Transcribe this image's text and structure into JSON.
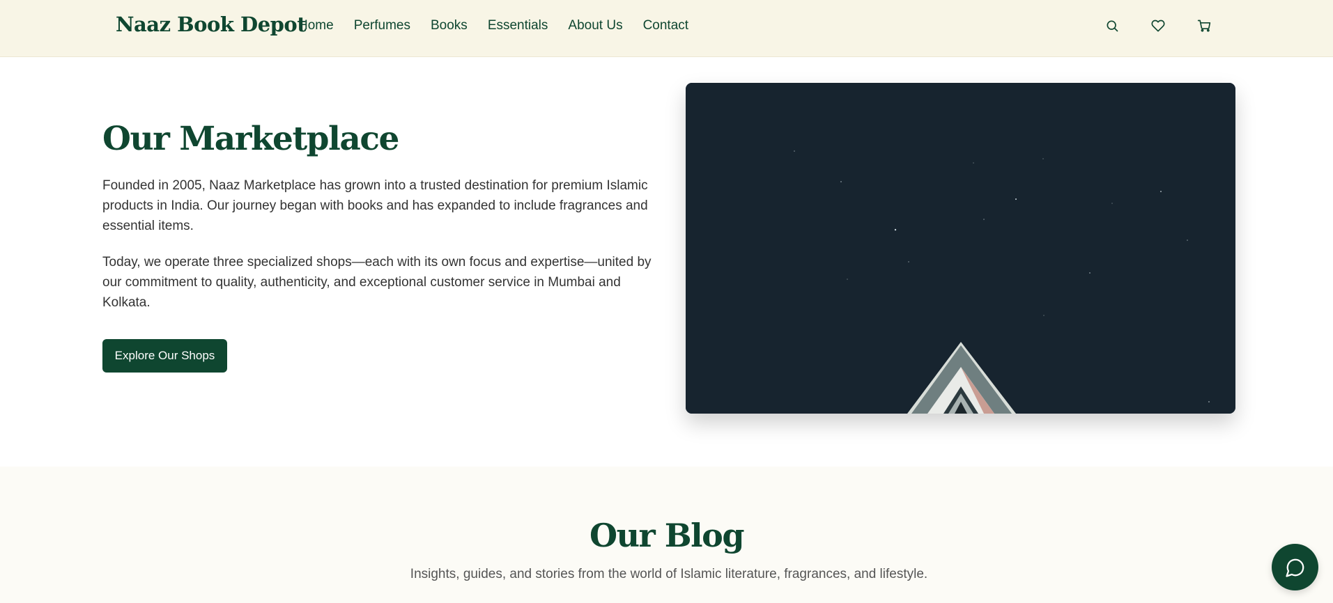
{
  "header": {
    "brand": "Naaz Book Depot",
    "nav": [
      "Home",
      "Perfumes",
      "Books",
      "Essentials",
      "About Us",
      "Contact"
    ],
    "icons": [
      "search-icon",
      "heart-icon",
      "cart-icon"
    ]
  },
  "hero": {
    "title": "Our Marketplace",
    "paragraph1": "Founded in 2005, Naaz Marketplace has grown into a trusted destination for premium Islamic products in India. Our journey began with books and has expanded to include fragrances and essential items.",
    "paragraph2": "Today, we operate three specialized shops—each with its own focus and expertise—united by our commitment to quality, authenticity, and exceptional customer service in Mumbai and Kolkata.",
    "cta_label": "Explore Our Shops"
  },
  "blog": {
    "title": "Our Blog",
    "subtitle": "Insights, guides, and stories from the world of Islamic literature, fragrances, and lifestyle."
  },
  "chat": {
    "icon": "chat-icon"
  },
  "colors": {
    "brand_green": "#0f4630",
    "header_bg": "#f8f5e6",
    "section_bg": "#fcfbf6",
    "image_bg": "#17242f"
  }
}
